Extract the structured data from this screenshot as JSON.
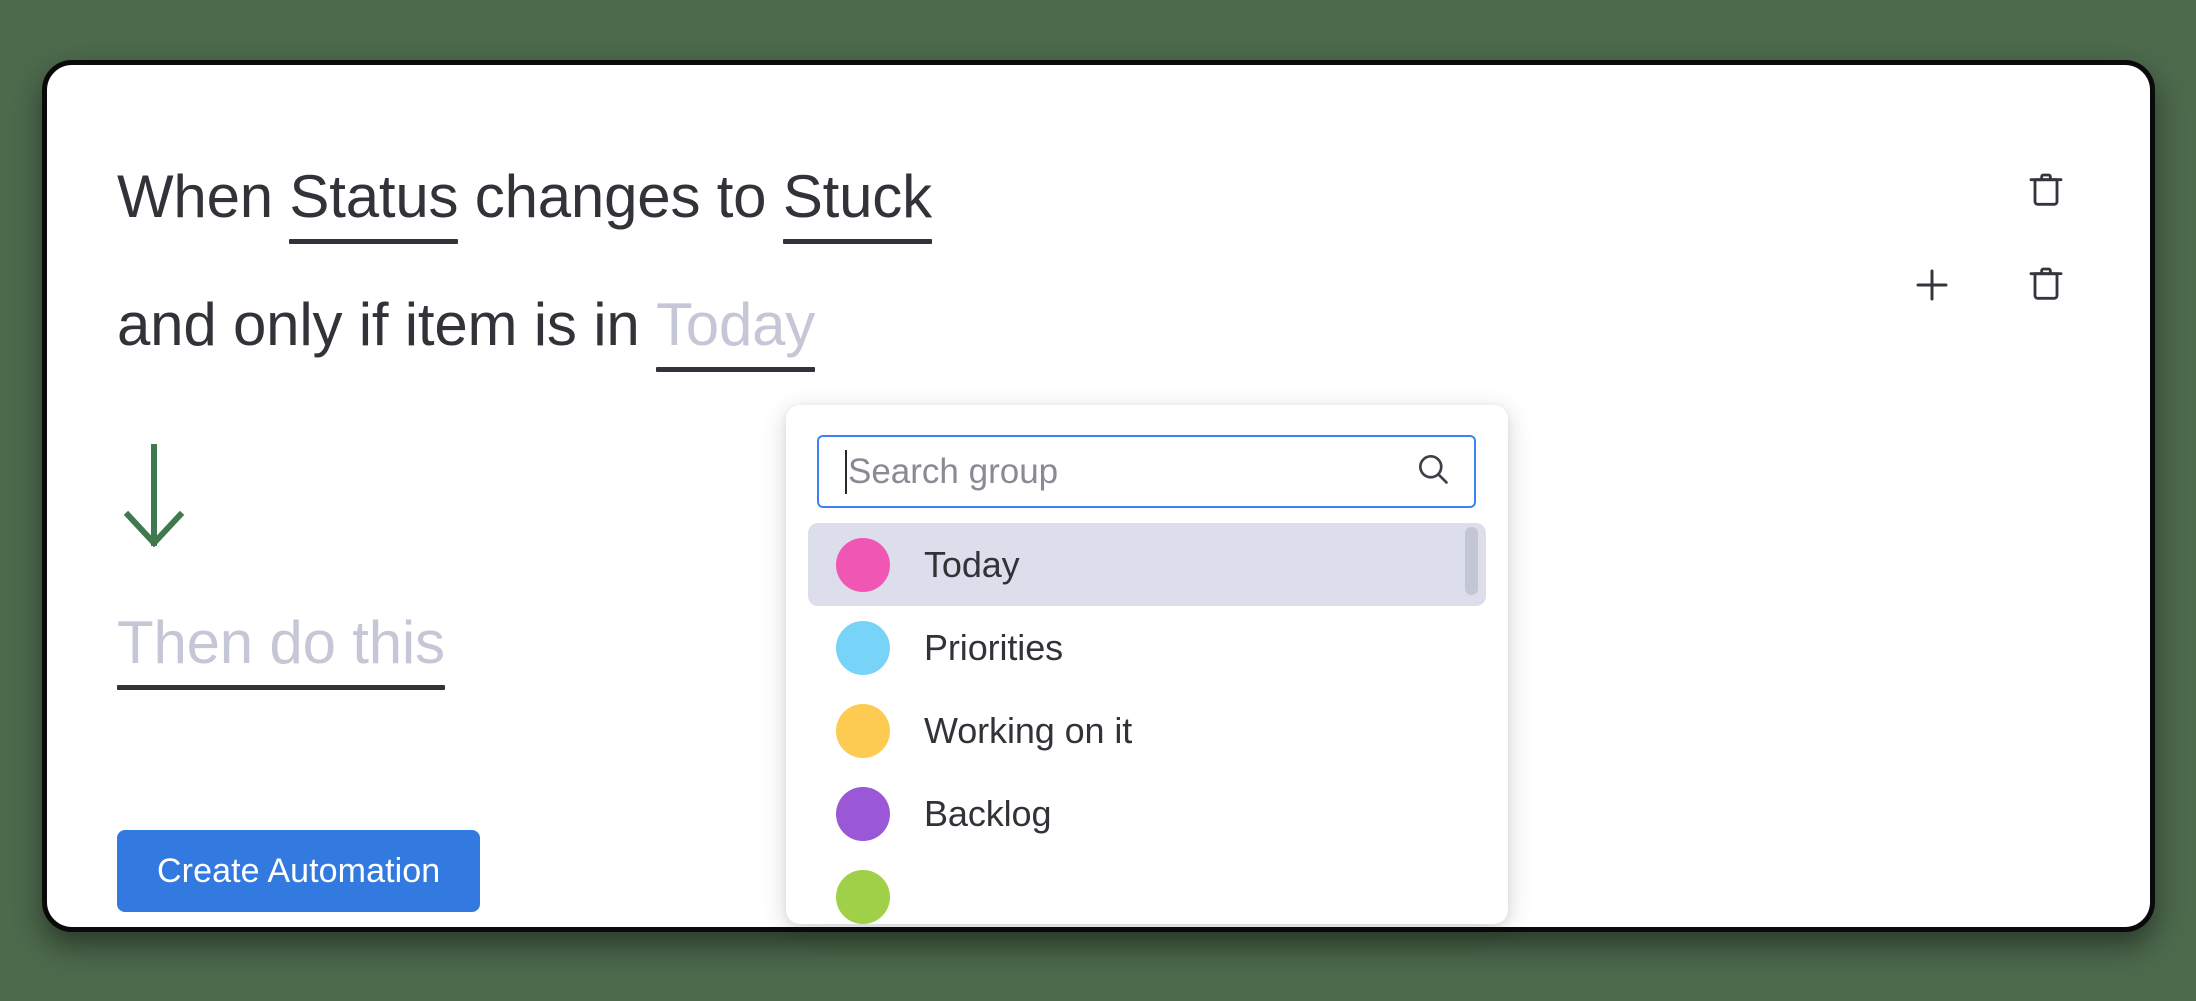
{
  "background_color": "#4d6a4d",
  "card": {
    "border_color": "#0a0a0a",
    "trigger": {
      "prefix": "When ",
      "column_token": "Status",
      "middle": " changes to ",
      "value_token": "Stuck",
      "delete_label": "trash-can"
    },
    "condition": {
      "prefix": "and only if item is in ",
      "group_token": "Today",
      "group_token_is_placeholder": true,
      "add_label": "plus",
      "delete_label": "trash-can"
    },
    "arrow": {
      "direction": "down",
      "color": "#3f7a4e"
    },
    "then": {
      "placeholder_text": "Then do this"
    },
    "primary_button": {
      "label": "Create Automation",
      "color": "#337ae0",
      "text_color": "#ffffff"
    }
  },
  "dropdown": {
    "search": {
      "placeholder": "Search group",
      "value": "",
      "icon": "search-icon",
      "focus_color": "#3b82f6"
    },
    "selected_option": "Today",
    "scrollbar_visible": true,
    "options": [
      {
        "label": "Today",
        "color": "#f056b4",
        "selected": true,
        "clipped": false
      },
      {
        "label": "Priorities",
        "color": "#77d3f8",
        "selected": false,
        "clipped": false
      },
      {
        "label": "Working on it",
        "color": "#fdcb52",
        "selected": false,
        "clipped": false
      },
      {
        "label": "Backlog",
        "color": "#9b58d6",
        "selected": false,
        "clipped": false
      },
      {
        "label": "",
        "color": "#9fd048",
        "selected": false,
        "clipped": true
      }
    ]
  }
}
